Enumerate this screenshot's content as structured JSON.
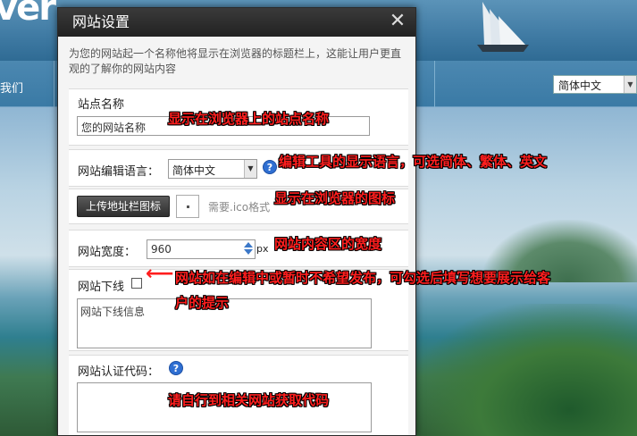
{
  "background": {
    "logo_fragment": "ver",
    "nav_item": "我们",
    "language_select": "简体中文"
  },
  "dialog": {
    "title": "网站设置",
    "close_glyph": "✕",
    "intro": "为您的网站起一个名称他将显示在浏览器的标题栏上，这能让用户更直观的了解你的网站内容",
    "site_name": {
      "label": "站点名称",
      "value": "您的网站名称"
    },
    "editor_language": {
      "label": "网站编辑语言：",
      "selected": "简体中文"
    },
    "favicon": {
      "button": "上传地址栏图标",
      "hint": "需要.ico格式"
    },
    "site_width": {
      "label": "网站宽度：",
      "value": "960",
      "unit": "px"
    },
    "offline": {
      "label": "网站下线",
      "checked": false,
      "textarea_value": "网站下线信息"
    },
    "verification": {
      "label": "网站认证代码：",
      "value": ""
    }
  },
  "annotations": {
    "site_name": "显示在浏览器上的站点名称",
    "editor_language": "编辑工具的显示语言，可选简体、繁体、英文",
    "favicon": "显示在浏览器的图标",
    "site_width": "网站内容区的宽度",
    "offline_line1": "网站如在编辑中或暂时不希望发布，可勾选后填写想要展示给客",
    "offline_line2": "户的提示",
    "verification": "请自行到相关网站获取代码"
  },
  "icons": {
    "close": "close-icon",
    "help": "help-icon",
    "arrow": "arrow-left-icon"
  }
}
